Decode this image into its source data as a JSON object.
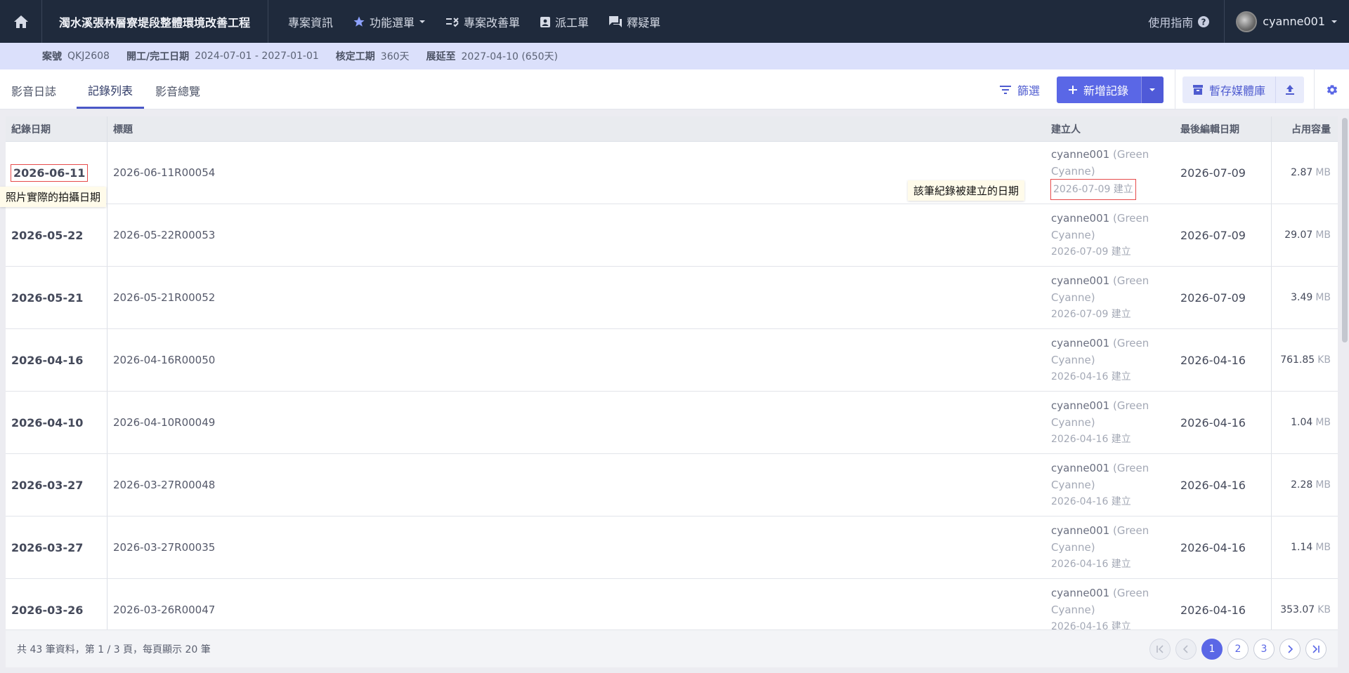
{
  "nav": {
    "project_title": "濁水溪張林層寮堤段整體環境改善工程",
    "items": [
      {
        "label": "專案資訊",
        "icon": "none"
      },
      {
        "label": "功能選單",
        "icon": "star-icon"
      },
      {
        "label": "專案改善單",
        "icon": "checklist-icon"
      },
      {
        "label": "派工單",
        "icon": "clipboard-icon"
      },
      {
        "label": "釋疑單",
        "icon": "chat-icon"
      }
    ],
    "guide": "使用指南",
    "user": "cyanne001"
  },
  "info": {
    "case_label": "案號",
    "case_value": "QKJ2608",
    "dates_label": "開工/完工日期",
    "dates_value": "2024-07-01 - 2027-01-01",
    "period_label": "核定工期",
    "period_value": "360天",
    "extend_label": "展延至",
    "extend_value": "2027-04-10 (650天)"
  },
  "sub": {
    "module_title": "影音日誌",
    "tabs": [
      "記錄列表",
      "影音總覽"
    ],
    "filter": "篩選",
    "add": "新增記錄",
    "stash": "暫存媒體庫"
  },
  "table": {
    "headers": [
      "紀錄日期",
      "標題",
      "建立人",
      "最後編輯日期",
      "占用容量"
    ],
    "rows": [
      {
        "date": "2026-06-11",
        "title": "2026-06-11R00054",
        "creator": "cyanne001",
        "creator_full": "(Green Cyanne)",
        "created": "2026-07-09 建立",
        "edited": "2026-07-09",
        "size": "2.87",
        "unit": "MB"
      },
      {
        "date": "2026-05-22",
        "title": "2026-05-22R00053",
        "creator": "cyanne001",
        "creator_full": "(Green Cyanne)",
        "created": "2026-07-09 建立",
        "edited": "2026-07-09",
        "size": "29.07",
        "unit": "MB"
      },
      {
        "date": "2026-05-21",
        "title": "2026-05-21R00052",
        "creator": "cyanne001",
        "creator_full": "(Green Cyanne)",
        "created": "2026-07-09 建立",
        "edited": "2026-07-09",
        "size": "3.49",
        "unit": "MB"
      },
      {
        "date": "2026-04-16",
        "title": "2026-04-16R00050",
        "creator": "cyanne001",
        "creator_full": "(Green Cyanne)",
        "created": "2026-04-16 建立",
        "edited": "2026-04-16",
        "size": "761.85",
        "unit": "KB"
      },
      {
        "date": "2026-04-10",
        "title": "2026-04-10R00049",
        "creator": "cyanne001",
        "creator_full": "(Green Cyanne)",
        "created": "2026-04-16 建立",
        "edited": "2026-04-16",
        "size": "1.04",
        "unit": "MB"
      },
      {
        "date": "2026-03-27",
        "title": "2026-03-27R00048",
        "creator": "cyanne001",
        "creator_full": "(Green Cyanne)",
        "created": "2026-04-16 建立",
        "edited": "2026-04-16",
        "size": "2.28",
        "unit": "MB"
      },
      {
        "date": "2026-03-27",
        "title": "2026-03-27R00035",
        "creator": "cyanne001",
        "creator_full": "(Green Cyanne)",
        "created": "2026-04-16 建立",
        "edited": "2026-04-16",
        "size": "1.14",
        "unit": "MB"
      },
      {
        "date": "2026-03-26",
        "title": "2026-03-26R00047",
        "creator": "cyanne001",
        "creator_full": "(Green Cyanne)",
        "created": "2026-04-16 建立",
        "edited": "2026-04-16",
        "size": "353.07",
        "unit": "KB"
      }
    ]
  },
  "footer": {
    "summary": "共 43 筆資料，第 1 / 3 頁，每頁顯示 20 筆",
    "pages": [
      "1",
      "2",
      "3"
    ]
  },
  "annotations": {
    "photo_date": "照片實際的拍攝日期",
    "created_date": "該筆紀錄被建立的日期"
  },
  "colors": {
    "nav_bg": "#1f2a3c",
    "info_bg": "#dbe0fb",
    "accent": "#5a67e6",
    "highlight": "#e64a4a"
  }
}
